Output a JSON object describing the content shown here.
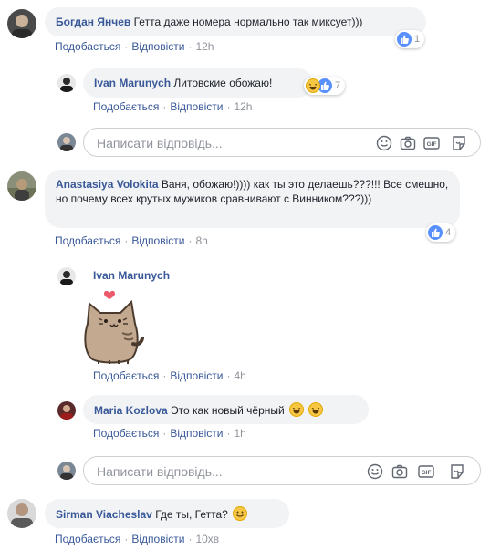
{
  "actions": {
    "like": "Подобається",
    "reply": "Відповісти",
    "separator": "·"
  },
  "reply_placeholder": "Написати відповідь...",
  "comments": [
    {
      "author": "Богдан Янчев",
      "text": "Гетта даже номера нормально так миксует)))",
      "time": "12h",
      "reactions_count": "1"
    },
    {
      "author": "Ivan Marunych",
      "text": "Литовские обожаю!",
      "time": "12h",
      "reactions_count": "7"
    },
    {
      "author": "Anastasiya Volokita",
      "text": "Ваня, обожаю!)))) как ты это делаешь???!!! Все смешно, но почему всех крутых мужиков сравнивают с Винником???)))",
      "time": "8h",
      "reactions_count": "4"
    },
    {
      "author": "Ivan Marunych",
      "sticker": "pusheen-cat-sticker",
      "time": "4h"
    },
    {
      "author": "Maria Kozlova",
      "text": "Это как новый чёрный",
      "time": "1h"
    },
    {
      "author": "Sirman Viacheslav",
      "text": "Где ты, Гетта?",
      "time": "10хв"
    }
  ],
  "colors": {
    "link": "#385898",
    "meta": "#90949c",
    "bubble": "#f2f3f5",
    "like_blue": "#5890ff"
  }
}
